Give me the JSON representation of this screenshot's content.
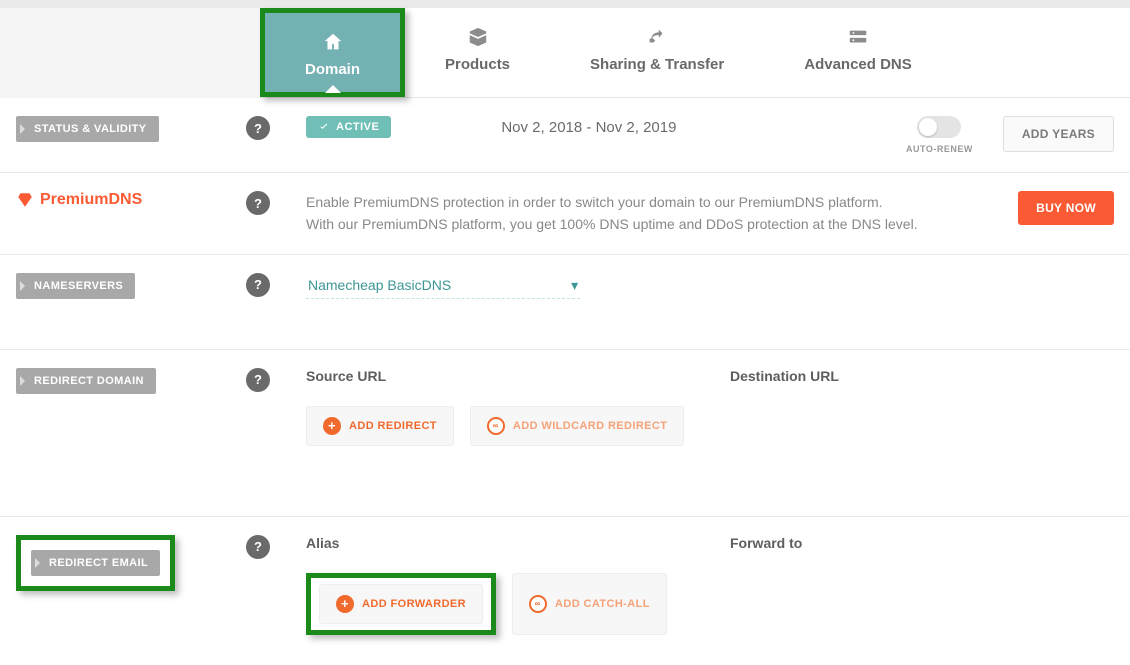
{
  "tabs": [
    {
      "label": "Domain",
      "icon": "home",
      "active": true
    },
    {
      "label": "Products",
      "icon": "box",
      "active": false
    },
    {
      "label": "Sharing & Transfer",
      "icon": "share",
      "active": false
    },
    {
      "label": "Advanced DNS",
      "icon": "server",
      "active": false
    }
  ],
  "status": {
    "label": "STATUS & VALIDITY",
    "badge": "ACTIVE",
    "dates": "Nov 2, 2018 - Nov 2, 2019",
    "autoRenewLabel": "AUTO-RENEW",
    "addYears": "ADD YEARS"
  },
  "premium": {
    "brandPre": "Premium",
    "brandStrong": "DNS",
    "line1": "Enable PremiumDNS protection in order to switch your domain to our PremiumDNS platform.",
    "line2": "With our PremiumDNS platform, you get 100% DNS uptime and DDoS protection at the DNS level.",
    "buy": "BUY NOW"
  },
  "nameservers": {
    "label": "NAMESERVERS",
    "value": "Namecheap BasicDNS"
  },
  "redirectDomain": {
    "label": "REDIRECT DOMAIN",
    "col1": "Source URL",
    "col2": "Destination URL",
    "addRedirect": "ADD REDIRECT",
    "addWildcard": "ADD WILDCARD REDIRECT"
  },
  "redirectEmail": {
    "label": "REDIRECT EMAIL",
    "col1": "Alias",
    "col2": "Forward to",
    "addForwarder": "ADD FORWARDER",
    "addCatchAll": "ADD CATCH-ALL"
  }
}
